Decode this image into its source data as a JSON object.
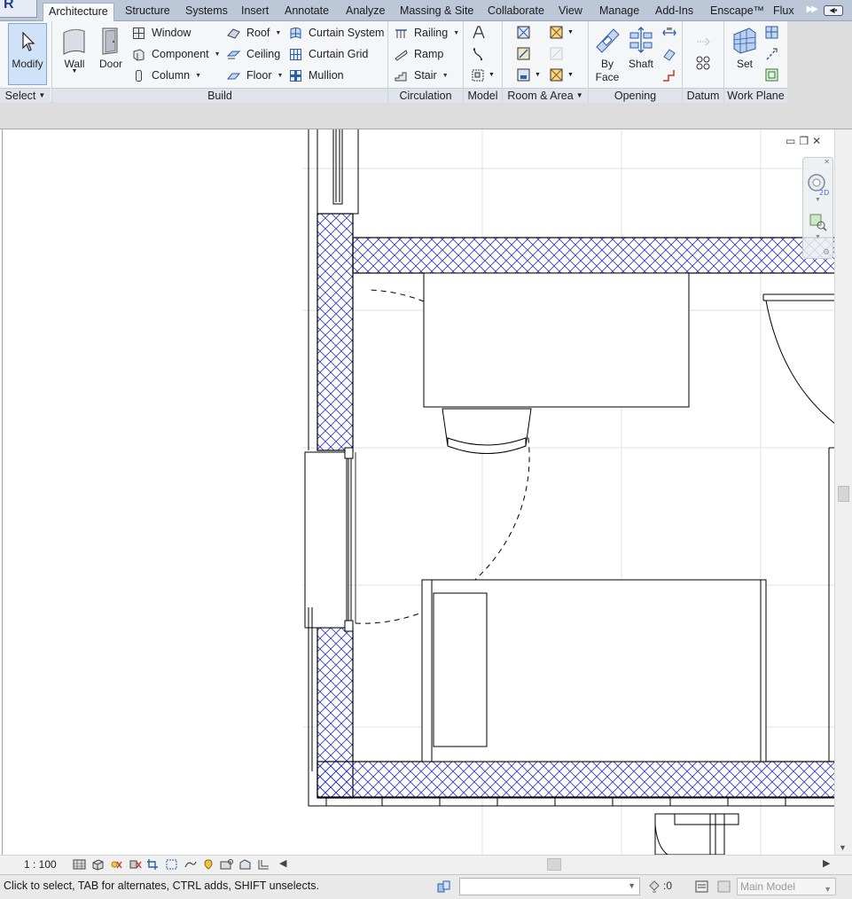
{
  "window": {
    "app_button": "R"
  },
  "tabs": [
    {
      "label": "Architecture",
      "active": true
    },
    {
      "label": "Structure"
    },
    {
      "label": "Systems"
    },
    {
      "label": "Insert"
    },
    {
      "label": "Annotate"
    },
    {
      "label": "Analyze"
    },
    {
      "label": "Massing & Site"
    },
    {
      "label": "Collaborate"
    },
    {
      "label": "View"
    },
    {
      "label": "Manage"
    },
    {
      "label": "Add-Ins"
    },
    {
      "label": "Enscape™"
    },
    {
      "label": "Flux"
    }
  ],
  "ribbon": {
    "select": {
      "modify": "Modify",
      "panel": "Select"
    },
    "build": {
      "wall": "Wall",
      "door": "Door",
      "window": "Window",
      "component": "Component",
      "column": "Column",
      "roof": "Roof",
      "ceiling": "Ceiling",
      "floor": "Floor",
      "curtain_system": "Curtain  System",
      "curtain_grid": "Curtain  Grid",
      "mullion": "Mullion",
      "panel": "Build"
    },
    "circulation": {
      "railing": "Railing",
      "ramp": "Ramp",
      "stair": "Stair",
      "panel": "Circulation"
    },
    "model": {
      "panel": "Model"
    },
    "room_area": {
      "panel": "Room & Area"
    },
    "opening": {
      "by_face": "By\nFace",
      "by_face_l1": "By",
      "by_face_l2": "Face",
      "shaft": "Shaft",
      "panel": "Opening"
    },
    "datum": {
      "panel": "Datum"
    },
    "work_plane": {
      "set": "Set",
      "panel": "Work Plane"
    }
  },
  "view_bar": {
    "scale": "1 : 100"
  },
  "status_bar": {
    "message": "Click to select, TAB for alternates, CTRL adds, SHIFT unselects.",
    "filter_count": ":0",
    "model": "Main Model"
  },
  "colors": {
    "hatch": "#2c34c4",
    "accent": "#cfe2f8",
    "ribbon": "#f5f6f8"
  }
}
